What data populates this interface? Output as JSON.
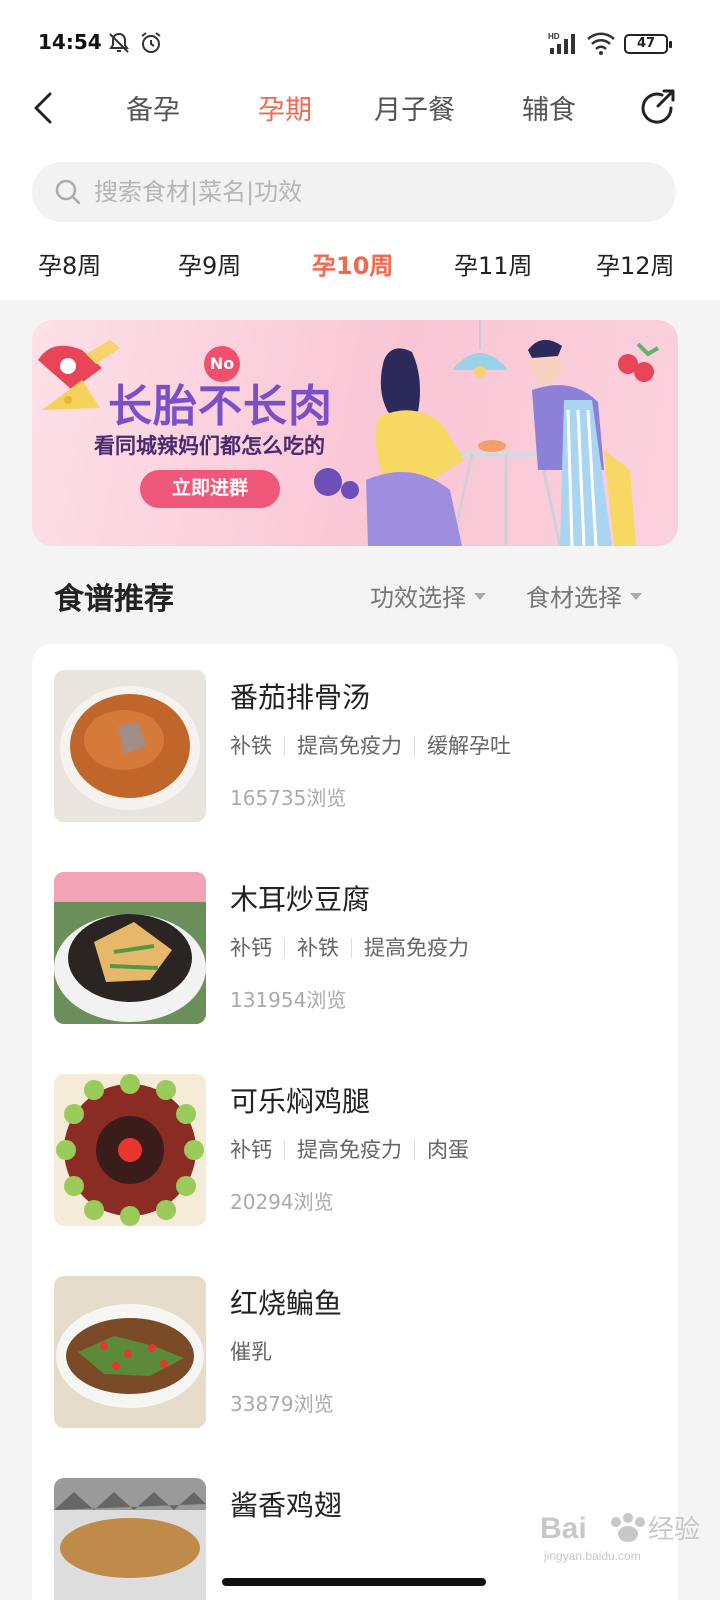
{
  "status_bar": {
    "time": "14:54",
    "battery": "47"
  },
  "nav": {
    "tabs": [
      {
        "label": "备孕"
      },
      {
        "label": "孕期"
      },
      {
        "label": "月子餐"
      },
      {
        "label": "辅食"
      }
    ],
    "active_tab": "孕期"
  },
  "search": {
    "placeholder": "搜索食材|菜名|功效"
  },
  "weeks": {
    "items": [
      "孕8周",
      "孕9周",
      "孕10周",
      "孕11周",
      "孕12周"
    ],
    "active": "孕10周"
  },
  "banner": {
    "title": "长胎不长肉",
    "badge": "No",
    "subtitle": "看同城辣妈们都怎么吃的",
    "button": "立即进群"
  },
  "section": {
    "title": "食谱推荐",
    "filter_effect": "功效选择",
    "filter_ingredient": "食材选择"
  },
  "recipes": [
    {
      "title": "番茄排骨汤",
      "tags": [
        "补铁",
        "提高免疫力",
        "缓解孕吐"
      ],
      "views": "165735浏览"
    },
    {
      "title": "木耳炒豆腐",
      "tags": [
        "补钙",
        "补铁",
        "提高免疫力"
      ],
      "views": "131954浏览"
    },
    {
      "title": "可乐焖鸡腿",
      "tags": [
        "补钙",
        "提高免疫力",
        "肉蛋"
      ],
      "views": "20294浏览"
    },
    {
      "title": "红烧鳊鱼",
      "tags": [
        "催乳"
      ],
      "views": "33879浏览"
    },
    {
      "title": "酱香鸡翅",
      "tags": [],
      "views": ""
    }
  ],
  "colors": {
    "accent": "#ef6a50",
    "banner_purple": "#7a4fc7",
    "banner_button": "#f0587a"
  }
}
